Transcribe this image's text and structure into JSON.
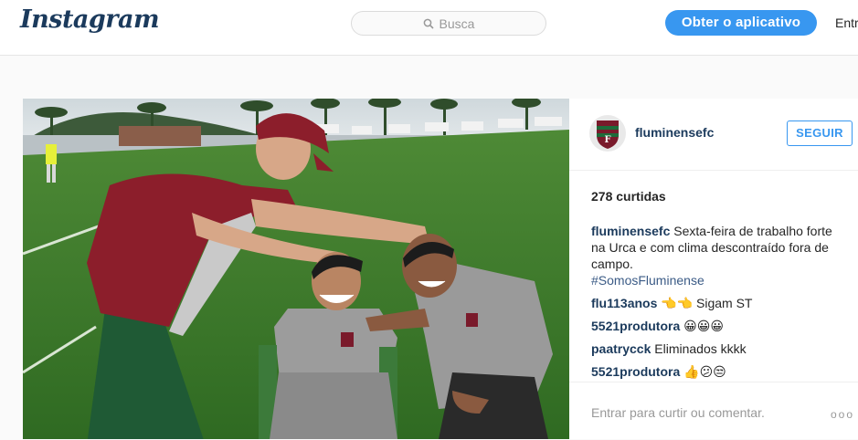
{
  "nav": {
    "logo": "Instagram",
    "search_placeholder": "Busca",
    "get_app_label": "Obter o aplicativo",
    "login_label": "Entrar"
  },
  "post": {
    "username": "fluminensefc",
    "follow_label": "SEGUIR",
    "likes": "278 curtidas",
    "caption": {
      "username": "fluminensefc",
      "text": "Sexta-feira de trabalho forte na Urca e com clima descontraído fora de campo.",
      "hashtag": "#SomosFluminense"
    },
    "comments": [
      {
        "user": "flu113anos",
        "text": "👈👈 Sigam ST"
      },
      {
        "user": "5521produtora",
        "text": "😀😀😀"
      },
      {
        "user": "paatrycck",
        "text": "Eliminados kkkk"
      },
      {
        "user": "5521produtora",
        "text": "👍😕😒"
      }
    ],
    "login_prompt": "Entrar para curtir ou comentar.",
    "more_label": "ooo"
  },
  "colors": {
    "primary_blue": "#3897f0",
    "brand_navy": "#1b3a5c",
    "club_maroon": "#7a1a2b",
    "club_green": "#1e6b3a"
  }
}
